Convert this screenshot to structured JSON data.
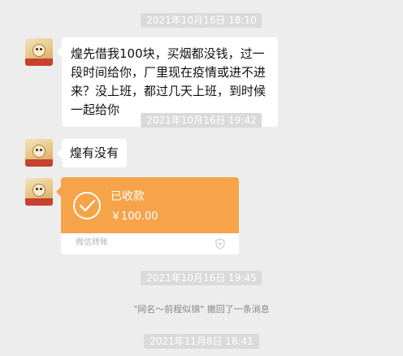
{
  "chat": {
    "timestamps": [
      "2021年10月16日 18:10",
      "2021年10月16日 19:42",
      "2021年10月16日 19:45",
      "2021年11月8日 18:41"
    ],
    "messages": [
      {
        "text": "煌先借我100块，买烟都没钱，过一段时间给你，厂里现在疫情或进不进来？没上班，都过几天上班，到时候一起给你"
      },
      {
        "text": "煌有没有"
      }
    ],
    "transfer": {
      "status": "已收款",
      "amount": "￥100.00",
      "footer": "微信转账",
      "accent_color": "#f6a34a"
    },
    "system_notice": "\"网名～前程似锦\" 撤回了一条消息"
  }
}
